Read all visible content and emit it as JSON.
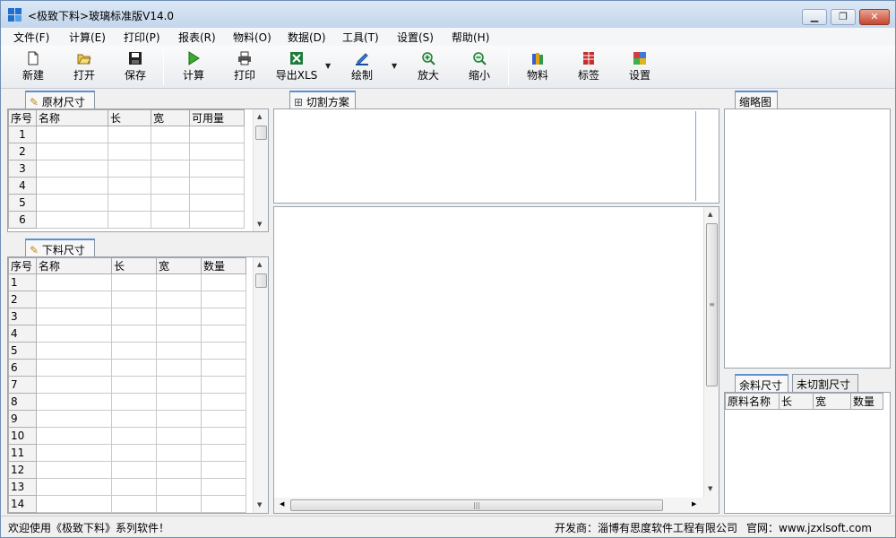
{
  "window": {
    "title": "<极致下料>玻璃标准版V14.0",
    "minimize_label": "▁",
    "restore_label": "❐",
    "close_label": "✕"
  },
  "menu": [
    {
      "label": "文件(F)"
    },
    {
      "label": "计算(E)"
    },
    {
      "label": "打印(P)"
    },
    {
      "label": "报表(R)"
    },
    {
      "label": "物料(O)"
    },
    {
      "label": "数据(D)"
    },
    {
      "label": "工具(T)"
    },
    {
      "label": "设置(S)"
    },
    {
      "label": "帮助(H)"
    }
  ],
  "toolbar": {
    "new": "新建",
    "open": "打开",
    "save": "保存",
    "calculate": "计算",
    "print": "打印",
    "export_xls": "导出XLS",
    "draw": "绘制",
    "zoom_in": "放大",
    "zoom_out": "缩小",
    "material": "物料",
    "label": "标签",
    "settings": "设置"
  },
  "raw_material_panel": {
    "tab": "原材尺寸",
    "columns": [
      "序号",
      "名称",
      "长",
      "宽",
      "可用量"
    ],
    "row_numbers": [
      "1",
      "2",
      "3",
      "4",
      "5",
      "6"
    ]
  },
  "cut_size_panel": {
    "tab": "下料尺寸",
    "columns": [
      "序号",
      "名称",
      "长",
      "宽",
      "数量"
    ],
    "row_numbers": [
      "1",
      "2",
      "3",
      "4",
      "5",
      "6",
      "7",
      "8",
      "9",
      "10",
      "11",
      "12",
      "13",
      "14"
    ]
  },
  "cutting_plan_panel": {
    "tab": "切割方案"
  },
  "thumbnail_panel": {
    "tab": "缩略图"
  },
  "remainder_panel": {
    "tabs": [
      "余料尺寸",
      "未切割尺寸"
    ],
    "columns": [
      "原料名称",
      "长",
      "宽",
      "数量"
    ]
  },
  "status": {
    "welcome": "欢迎使用《极致下料》系列软件！",
    "developer": "开发商：淄博有思度软件工程有限公司",
    "website": "官网：www.jzxlsoft.com"
  },
  "colors": {
    "accent": "#5b8fd6",
    "titlebar": "#c4d6ec",
    "close_button": "#c7462f"
  }
}
